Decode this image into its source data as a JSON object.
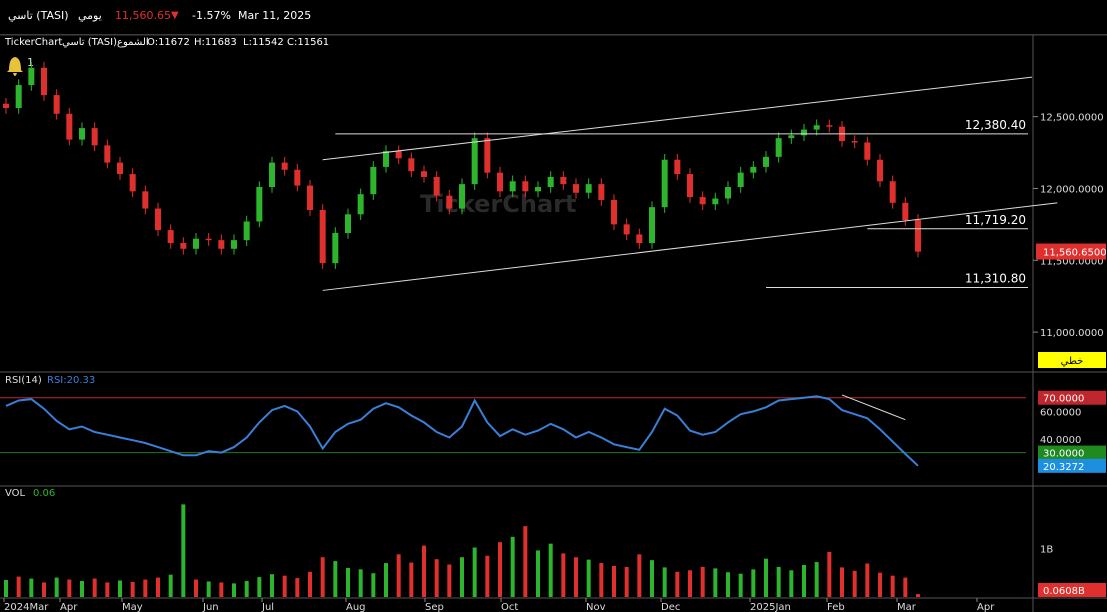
{
  "header": {
    "symbol": "تاسي (TASI)",
    "period": "يومي",
    "price": "11,560.65",
    "change_pct": "-1.57%",
    "date": "Mar 11, 2025"
  },
  "info_bar": {
    "brand": "TickerChart",
    "name": "تاسي (TASI)",
    "type": "الشموع",
    "open": "O:11672",
    "high": "H:11683",
    "low": "L:11542",
    "close": "C:11561"
  },
  "alert_count": "1",
  "watermark": "TickerChart",
  "linear_label": "خطي",
  "colors": {
    "up": "#2db52d",
    "down": "#e0302e",
    "rsi": "#3a7fd8",
    "bg": "#000000",
    "grid": "#333333",
    "upper_band": "#c0262d",
    "lower_band": "#1f7a1f",
    "label_bg": "#e0302e",
    "label_rsi": "#1c8fe0",
    "label_green": "#1f8a1f",
    "linear_bg": "#ffff00"
  },
  "chart_data": {
    "type": "candlestick",
    "price_axis": {
      "ticks": [
        "12,500.0000",
        "12,000.0000",
        "11,500.0000",
        "11,000.0000"
      ],
      "ylim": [
        10750,
        12950
      ]
    },
    "months": [
      "2024Mar",
      "Apr",
      "May",
      "Jun",
      "Jul",
      "Aug",
      "Sep",
      "Oct",
      "Nov",
      "Dec",
      "2025Jan",
      "Feb",
      "Mar",
      "Apr"
    ],
    "last_price_label": "11,560.6500",
    "levels": [
      {
        "label": "12,380.40",
        "value": 12380.4
      },
      {
        "label": "11,719.20",
        "value": 11719.2
      },
      {
        "label": "11,310.80",
        "value": 11310.8
      }
    ],
    "closes_weekly": [
      12560,
      12720,
      12840,
      12650,
      12520,
      12340,
      12420,
      12300,
      12180,
      12100,
      11980,
      11860,
      11710,
      11620,
      11580,
      11650,
      11640,
      11580,
      11640,
      11770,
      12010,
      12180,
      12130,
      12020,
      11850,
      11480,
      11690,
      11820,
      11960,
      12150,
      12260,
      12210,
      12120,
      12080,
      11950,
      11860,
      12030,
      12350,
      12110,
      11980,
      12050,
      11980,
      12010,
      12080,
      12030,
      11970,
      12030,
      11920,
      11750,
      11680,
      11620,
      11870,
      12200,
      12100,
      11940,
      11890,
      11930,
      12010,
      12110,
      12150,
      12220,
      12350,
      12370,
      12410,
      12440,
      12430,
      12330,
      12320,
      12200,
      12050,
      11900,
      11780,
      11560
    ],
    "rsi": {
      "name": "RSI(14)",
      "value_label": "RSI:20.33",
      "ticks": [
        "70.0000",
        "60.0000",
        "40.0000",
        "30.0000",
        "20.3272"
      ],
      "upper": 70,
      "lower": 30,
      "last": 20.33,
      "values": [
        64,
        68,
        69,
        62,
        53,
        47,
        49,
        45,
        43,
        41,
        39,
        37,
        34,
        31,
        28,
        28,
        31,
        30,
        34,
        41,
        52,
        61,
        64,
        60,
        49,
        33,
        45,
        51,
        54,
        62,
        66,
        63,
        57,
        52,
        45,
        41,
        49,
        68,
        52,
        42,
        47,
        43,
        46,
        51,
        47,
        41,
        45,
        41,
        36,
        34,
        32,
        45,
        62,
        57,
        46,
        43,
        45,
        52,
        58,
        60,
        63,
        68,
        69,
        70,
        71,
        69,
        61,
        58,
        55,
        47,
        38,
        29,
        20.33
      ]
    },
    "volume": {
      "name": "VOL",
      "value_label": "0.06",
      "ticks": [
        "1B"
      ],
      "last_label": "0.0608B",
      "ylim": [
        0,
        2
      ],
      "values": [
        0.35,
        0.42,
        0.38,
        0.3,
        0.4,
        0.36,
        0.33,
        0.38,
        0.3,
        0.34,
        0.31,
        0.36,
        0.4,
        0.46,
        1.91,
        0.36,
        0.32,
        0.3,
        0.28,
        0.33,
        0.41,
        0.47,
        0.44,
        0.39,
        0.52,
        0.82,
        0.74,
        0.6,
        0.57,
        0.49,
        0.7,
        0.88,
        0.71,
        1.06,
        0.78,
        0.67,
        0.82,
        1.02,
        0.85,
        1.13,
        1.24,
        1.46,
        0.96,
        1.1,
        0.9,
        0.82,
        0.77,
        0.7,
        0.64,
        0.62,
        0.88,
        0.76,
        0.61,
        0.52,
        0.55,
        0.62,
        0.59,
        0.51,
        0.48,
        0.57,
        0.79,
        0.62,
        0.55,
        0.66,
        0.72,
        0.93,
        0.61,
        0.54,
        0.69,
        0.5,
        0.44,
        0.4,
        0.06
      ]
    },
    "volume_up_days": [
      true,
      false,
      true,
      false,
      true,
      false,
      true,
      false,
      false,
      true,
      false,
      false,
      false,
      true,
      true,
      false,
      true,
      false,
      true,
      true,
      true,
      true,
      false,
      false,
      false,
      false,
      true,
      true,
      true,
      true,
      true,
      false,
      false,
      false,
      false,
      false,
      true,
      true,
      false,
      false,
      true,
      false,
      true,
      true,
      false,
      false,
      true,
      false,
      false,
      false,
      false,
      true,
      true,
      false,
      false,
      false,
      true,
      true,
      true,
      true,
      true,
      true,
      true,
      true,
      true,
      false,
      false,
      false,
      false,
      false,
      false,
      false,
      false
    ]
  }
}
